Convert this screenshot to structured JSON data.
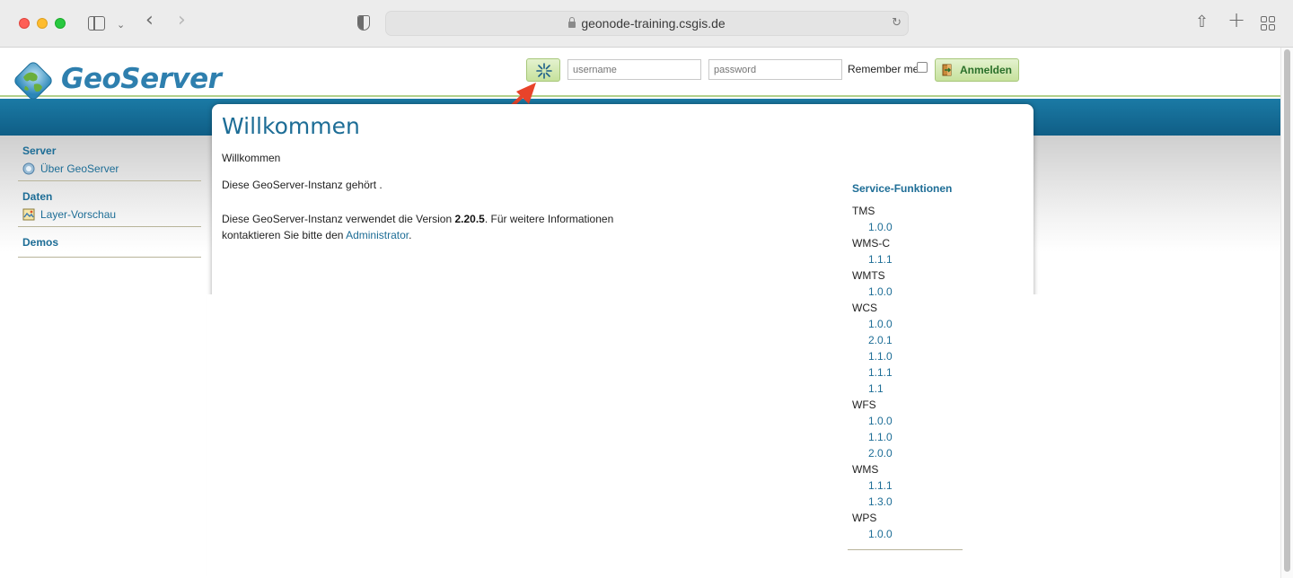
{
  "browser": {
    "url": "geonode-training.csgis.de"
  },
  "header": {
    "logo_text": "GeoServer",
    "username_placeholder": "username",
    "password_placeholder": "password",
    "remember_label": "Remember me",
    "login_button": "Anmelden"
  },
  "nav": {
    "sections": [
      {
        "heading": "Server",
        "items": [
          "Über GeoServer"
        ]
      },
      {
        "heading": "Daten",
        "items": [
          "Layer-Vorschau"
        ]
      },
      {
        "heading": "Demos",
        "items": []
      }
    ]
  },
  "main": {
    "title": "Willkommen",
    "subtitle": "Willkommen",
    "owner_text": "Diese GeoServer-Instanz gehört .",
    "version_prefix": "Diese GeoServer-Instanz verwendet die Version ",
    "version": "2.20.5",
    "version_suffix": ". Für weitere Informationen kontaktieren Sie bitte den ",
    "admin_link": "Administrator",
    "end": "."
  },
  "services": {
    "heading": "Service-Funktionen",
    "list": [
      {
        "name": "TMS",
        "versions": [
          "1.0.0"
        ]
      },
      {
        "name": "WMS-C",
        "versions": [
          "1.1.1"
        ]
      },
      {
        "name": "WMTS",
        "versions": [
          "1.0.0"
        ]
      },
      {
        "name": "WCS",
        "versions": [
          "1.0.0",
          "2.0.1",
          "1.1.0",
          "1.1.1",
          "1.1"
        ]
      },
      {
        "name": "WFS",
        "versions": [
          "1.0.0",
          "1.1.0",
          "2.0.0"
        ]
      },
      {
        "name": "WMS",
        "versions": [
          "1.1.1",
          "1.3.0"
        ]
      },
      {
        "name": "WPS",
        "versions": [
          "1.0.0"
        ]
      }
    ]
  },
  "colors": {
    "accent": "#1d6d96",
    "header_band": "#1b7aa5",
    "button_green": "#c6e19c",
    "annotation_arrow": "#e8432a"
  },
  "icons": [
    "sidebar-icon",
    "back-icon",
    "forward-icon",
    "shield-icon",
    "lock-icon",
    "reload-icon",
    "share-icon",
    "new-tab-icon",
    "tab-overview-icon",
    "geoserver-globe-icon",
    "key-icon",
    "login-door-icon",
    "info-icon",
    "layer-preview-icon",
    "annotation-arrow"
  ]
}
